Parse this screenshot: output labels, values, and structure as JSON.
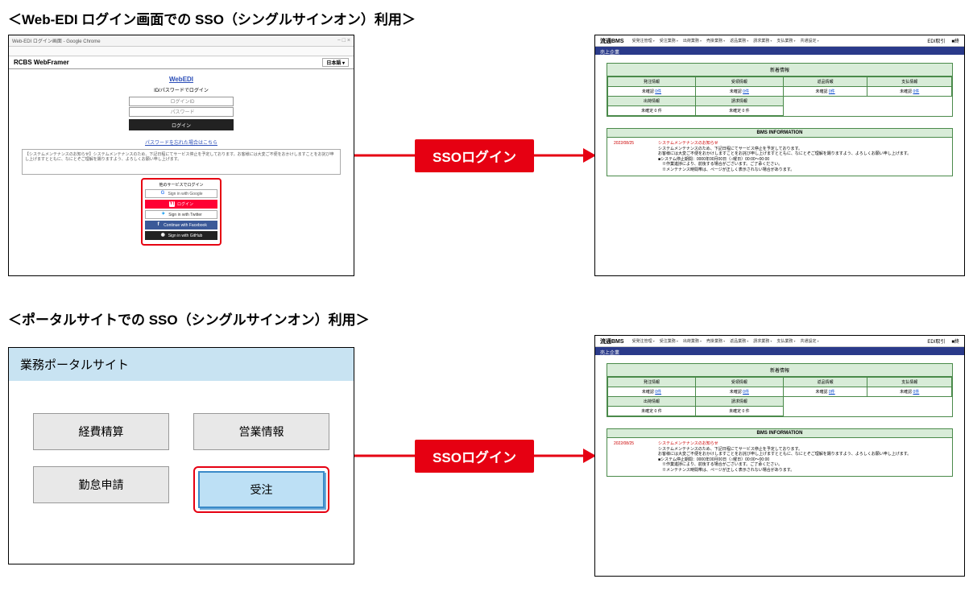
{
  "section1_title": "＜Web-EDI ログイン画面での SSO（シングルサインオン）利用＞",
  "section2_title": "＜ポータルサイトでの SSO（シングルサインオン）利用＞",
  "arrow_label": "SSOログイン",
  "login": {
    "window_title": "Web-EDI ログイン画面 - Google Chrome",
    "brand": "RCBS WebFramer",
    "lang": "日本語 ▾",
    "title": "WebEDI",
    "subtitle": "ID/パスワードでログイン",
    "placeholder_id": "ログインID",
    "placeholder_pw": "パスワード",
    "login_btn": "ログイン",
    "forgot": "パスワードを忘れた場合はこちら",
    "notice": "【システムメンテナンスのお知らせ】システムメンテナンスのため、下記日程にてサービス停止を予定しております。お客様には大変ご不便をおかけしますことをお詫び申し上げますとともに、なにとぞご理解を賜りますよう、よろしくお願い申し上げます。",
    "sso_title": "他のサービスでログイン",
    "sso_google": "Sign in with Google",
    "sso_yahoo": "ログイン",
    "sso_twitter": "Sign in with Twitter",
    "sso_facebook": "Continue with Facebook",
    "sso_github": "Sign in with GitHub"
  },
  "portal": {
    "title": "業務ポータルサイト",
    "btn1": "経費精算",
    "btn2": "営業情報",
    "btn3": "勤怠申請",
    "btn4": "受注"
  },
  "bms": {
    "logo": "流通BMS",
    "menu": [
      "受発注管理",
      "受注業務",
      "出荷業務",
      "売掛業務",
      "返品業務",
      "請求業務",
      "支払業務",
      "共通設定"
    ],
    "user": "EDI取引",
    "logout": "■終",
    "subbar": "売上企業",
    "table_title": "新着情報",
    "headers": [
      "発注情報",
      "受領情報",
      "返品情報",
      "支払情報"
    ],
    "row1": {
      "c1_a": "未確認",
      "c1_b": "0件",
      "c2_a": "未確認",
      "c2_b": "0件",
      "c3_a": "未確認",
      "c3_b": "0件",
      "c4_a": "未確認",
      "c4_b": "0件"
    },
    "row2": {
      "h1": "出荷情報",
      "h2": "請求情報"
    },
    "row3": {
      "c1": "未確定 0 件",
      "c2": "未確定 0 件"
    },
    "info_title": "BMS INFORMATION",
    "info_date": "2022/08/25",
    "info_head": "システムメンテナンスのお知らせ",
    "info_l1": "システムメンテナンスのため、下記日程にてサービス停止を予定しております。",
    "info_l2": "お客様には大変ご不便をおかけしますことをお詫び申し上げますとともに、なにとぞご理解を賜りますよう、よろしくお願い申し上げます。",
    "info_l3": "■システム停止期間：0000年00月00日（○曜日）00:00～00:00",
    "info_l4": "　※作業進捗により、前後する場合がございます。ご了承ください。",
    "info_l5": "　※メンテナンス時間帯は、ページが正しく表示されない場合があります。"
  }
}
